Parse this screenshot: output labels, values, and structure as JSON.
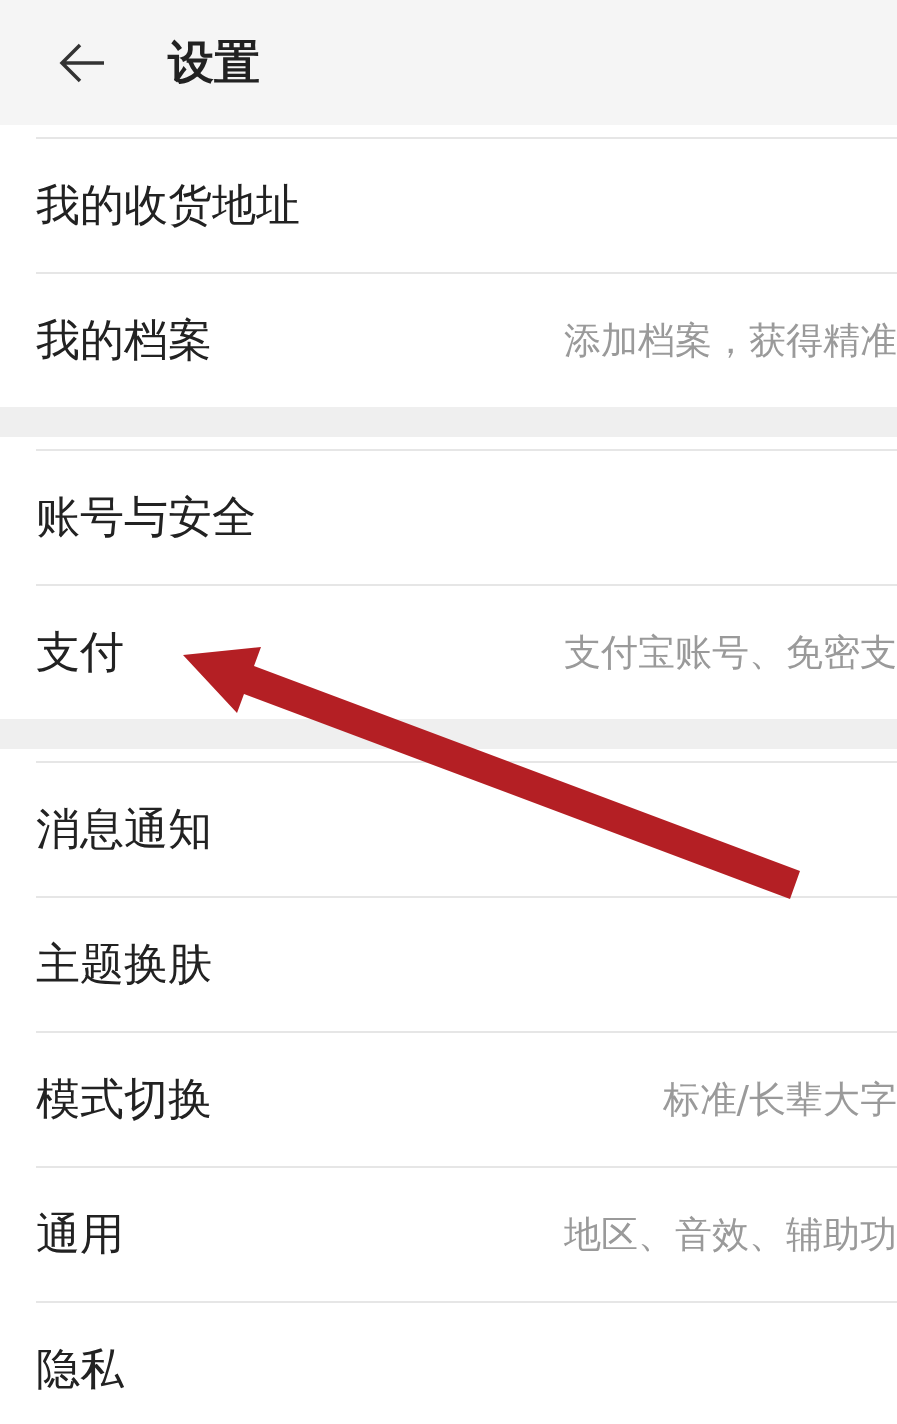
{
  "header": {
    "title": "设置"
  },
  "groups": [
    {
      "items": [
        {
          "label": "我的收货地址"
        },
        {
          "label": "我的档案",
          "hint": "添加档案，获得精准"
        }
      ]
    },
    {
      "items": [
        {
          "label": "账号与安全"
        },
        {
          "label": "支付",
          "hint": "支付宝账号、免密支"
        }
      ]
    },
    {
      "items": [
        {
          "label": "消息通知"
        },
        {
          "label": "主题换肤"
        },
        {
          "label": "模式切换",
          "hint": "标准/长辈大字"
        },
        {
          "label": "通用",
          "hint": "地区、音效、辅助功"
        },
        {
          "label": "隐私"
        }
      ]
    }
  ],
  "annotation": {
    "kind": "arrow"
  }
}
